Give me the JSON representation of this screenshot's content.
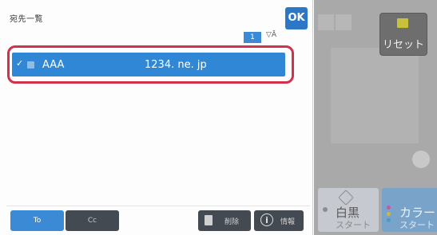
{
  "dialog": {
    "title": "宛先一覧",
    "ok_label": "OK",
    "page_number": "1",
    "sort_glyph": "▽Ā",
    "entries": [
      {
        "selected": true,
        "check": "✓",
        "name": "AAA",
        "address": "1234. ne. jp"
      }
    ],
    "footer": {
      "to_label": "To",
      "cc_label": "Cc",
      "delete_label": "削除",
      "info_label": "情報"
    }
  },
  "sidebar": {
    "reset_label": "リセット",
    "mono_label": "白黒",
    "mono_sub": "スタート",
    "color_label": "カラー",
    "color_sub": "スタート"
  },
  "icons": {
    "reset": "pencil-icon",
    "delete": "trash-icon",
    "info": "info-icon",
    "mono": "diamond-start-icon"
  },
  "colors": {
    "accent": "#2f87d6",
    "highlight": "#d1324a",
    "ok": "#2d78c6"
  }
}
